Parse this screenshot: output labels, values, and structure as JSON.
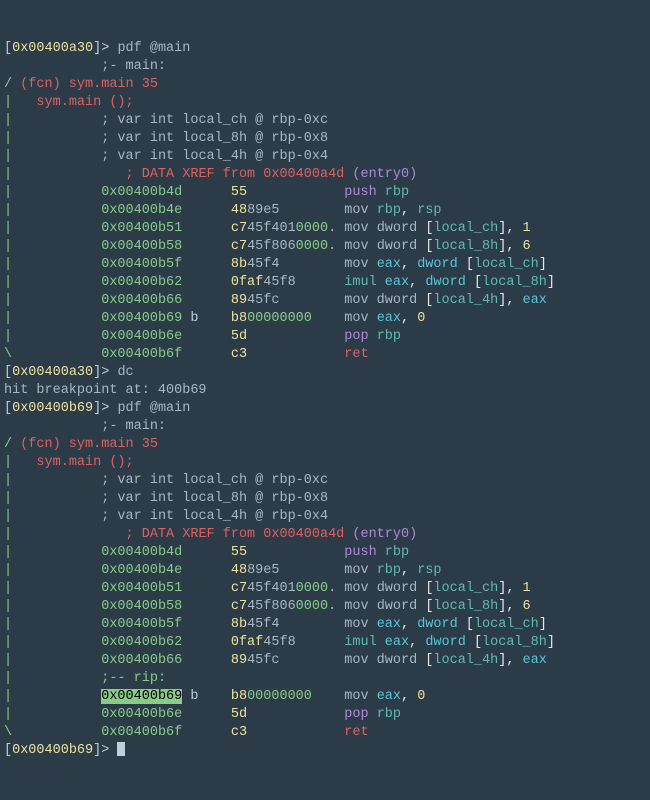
{
  "prompt1": {
    "addr": "0x00400a30",
    "cmd": "pdf @main"
  },
  "syminfo": {
    "symcomment": "-- main:",
    "fcn": "(fcn) sym.main 35",
    "call": "sym.main ();"
  },
  "vars": [
    "; var int local_ch @ rbp-0xc",
    "; var int local_8h @ rbp-0x8",
    "; var int local_4h @ rbp-0x4"
  ],
  "xref": {
    "p1": "; DATA XREF from 0x00400a4d ",
    "p2": "(entry0)"
  },
  "dc": {
    "cmd": "dc"
  },
  "bp": "hit breakpoint at: 400b69",
  "prompt2": {
    "addr": "0x00400b69",
    "cmd": "pdf @main"
  },
  "rip": ";-- rip:",
  "ins": [
    {
      "addr": "0x00400b4d",
      "b": "",
      "h1": "55",
      "h2": "",
      "h3": "",
      "m": "push",
      "op1": "rbp",
      "op2": "",
      "op3": ""
    },
    {
      "addr": "0x00400b4e",
      "b": "",
      "h1": "48",
      "h2": "89e5",
      "h3": "",
      "m": "mov",
      "op1": "rbp",
      "c1": ",",
      "op2": "rsp",
      "op3": ""
    },
    {
      "addr": "0x00400b51",
      "b": "",
      "h1": "c7",
      "h2": "45",
      "h2b": "f401",
      "h3": "0000",
      "h4": ".",
      "m": "mov dword",
      "cp": "[",
      "op1": "local_ch",
      "cp2": "],",
      "op2": "1"
    },
    {
      "addr": "0x00400b58",
      "b": "",
      "h1": "c7",
      "h2": "45",
      "h2b": "f806",
      "h3": "0000",
      "h4": ".",
      "m": "mov dword",
      "cp": "[",
      "op1": "local_8h",
      "cp2": "],",
      "op2": "6"
    },
    {
      "addr": "0x00400b5f",
      "b": "",
      "h1": "8b",
      "h2": "45",
      "h2b": "f4",
      "m": "mov",
      "op1": "eax",
      "c1": ",",
      "op2": "dword",
      "cp": "[",
      "op3": "local_ch",
      "cp2": "]"
    },
    {
      "addr": "0x00400b62",
      "b": "",
      "h1": "0faf",
      "h2": "45",
      "h2b": "f8",
      "m": "imul",
      "op1": "eax",
      "c1": ",",
      "op2": "dword",
      "cp": "[",
      "op3": "local_8h",
      "cp2": "]"
    },
    {
      "addr": "0x00400b66",
      "b": "",
      "h1": "89",
      "h2": "45",
      "h2b": "fc",
      "m": "mov dword",
      "cp": "[",
      "op1": "local_4h",
      "cp2": "],",
      "op2": "eax"
    },
    {
      "addr": "0x00400b69",
      "b": "b",
      "h1": "b8",
      "h3": "00000000",
      "m": "mov",
      "op1": "eax",
      "c1": ",",
      "op2": "0"
    },
    {
      "addr": "0x00400b6e",
      "b": "",
      "h1": "5d",
      "m": "pop",
      "op1": "rbp"
    },
    {
      "addr": "0x00400b6f",
      "b": "",
      "h1": "c3",
      "m": "ret"
    }
  ]
}
